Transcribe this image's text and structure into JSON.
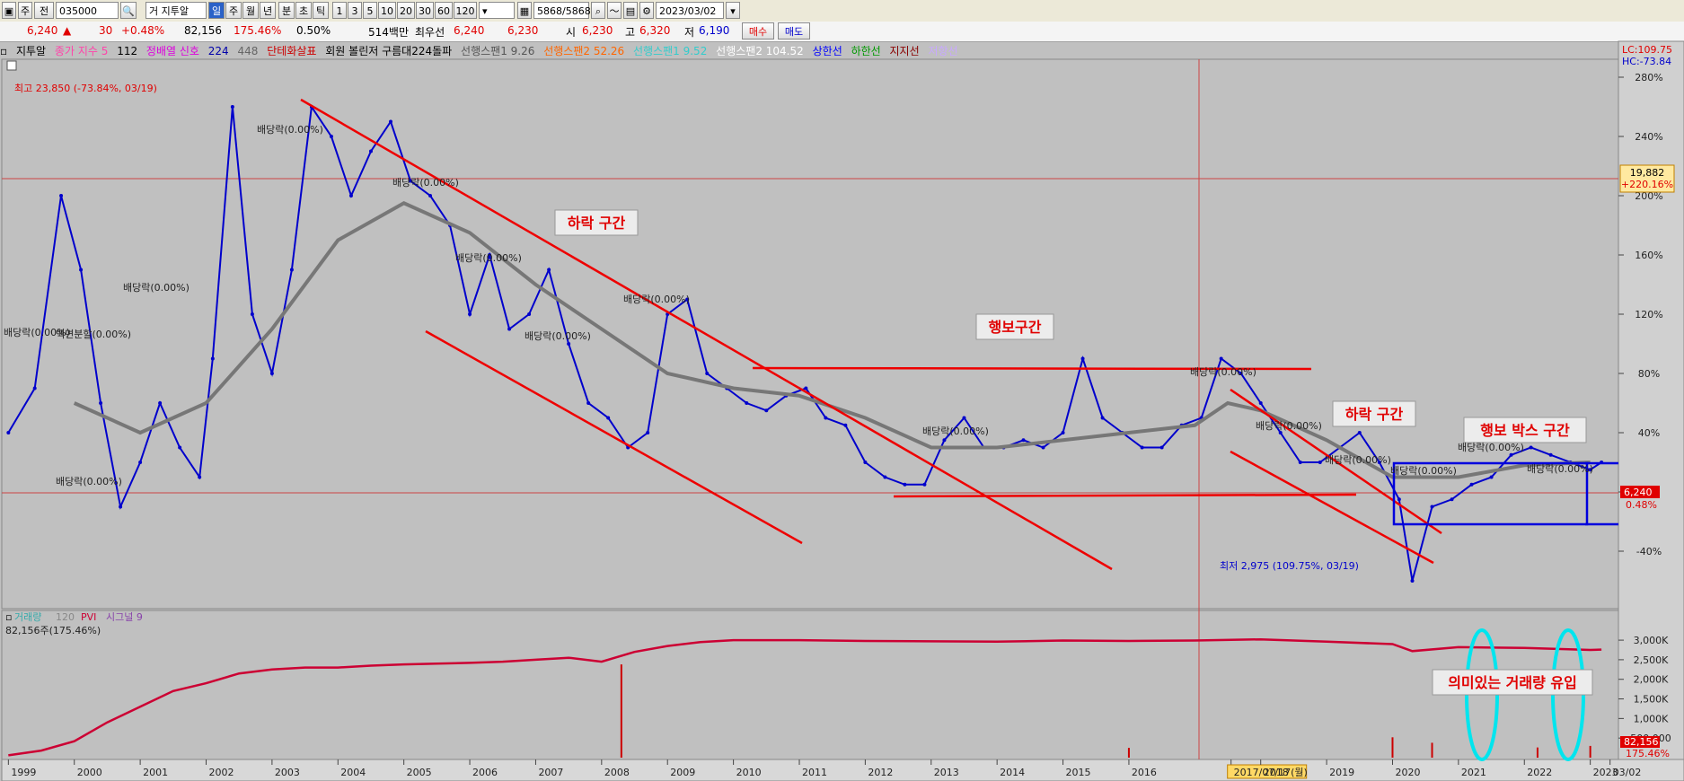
{
  "toolbar": {
    "code": "035000",
    "name": "지투알",
    "period_buttons": [
      "일",
      "주",
      "월",
      "년",
      "분",
      "초",
      "틱"
    ],
    "active_period": "일",
    "interval_buttons": [
      "1",
      "3",
      "5",
      "10",
      "20",
      "30",
      "60",
      "120"
    ],
    "count": "5868",
    "total": "/5868",
    "date": "2023/03/02",
    "buy_label": "매수",
    "sell_label": "매도",
    "left_buttons": [
      "주",
      "전"
    ]
  },
  "quote": {
    "price": "6,240",
    "arrow": "▲",
    "change": "30",
    "change_pct": "+0.48%",
    "volume": "82,156",
    "vol_ratio": "175.46%",
    "turnover": "0.50%",
    "amount": "514백만",
    "prior_label": "최우선",
    "ask": "6,240",
    "bid": "6,230",
    "open_label": "시",
    "open": "6,230",
    "high_label": "고",
    "high": "6,320",
    "low_label": "저",
    "low": "6,190"
  },
  "legend": [
    {
      "text": "지투알",
      "color": "#000000"
    },
    {
      "text": "종가 지수 5",
      "color": "#ff44aa"
    },
    {
      "text": "",
      "color": "#c8b400"
    },
    {
      "text": "112",
      "color": "#000000"
    },
    {
      "text": "정배열 신호",
      "color": "#dd00dd"
    },
    {
      "text": "224",
      "color": "#0000aa"
    },
    {
      "text": "448",
      "color": "#666666"
    },
    {
      "text": "단테화살표",
      "color": "#cc0000"
    },
    {
      "text": "회원 볼린저 구름대224돌파",
      "color": "#000000"
    },
    {
      "text": "선행스팬1 9.26",
      "color": "#555555"
    },
    {
      "text": "선행스팬2 52.26",
      "color": "#ff6600"
    },
    {
      "text": "선행스팬1 9.52",
      "color": "#33cccc"
    },
    {
      "text": "선행스팬2 104.52",
      "color": "#ffffff"
    },
    {
      "text": "상한선",
      "color": "#0000ff"
    },
    {
      "text": "하한선",
      "color": "#009900"
    },
    {
      "text": "지지선",
      "color": "#880000"
    },
    {
      "text": "저항선",
      "color": "#c8a8ff"
    }
  ],
  "chart_data": {
    "type": "line",
    "title": "지투알",
    "x_ticks": [
      "1999",
      "2000",
      "2001",
      "2002",
      "2003",
      "2004",
      "2005",
      "2006",
      "2007",
      "2008",
      "2009",
      "2010",
      "2011",
      "2012",
      "2013",
      "2014",
      "2015",
      "2016",
      "2017/07/17(월)",
      "2018",
      "2019",
      "2020",
      "2021",
      "2022",
      "2023",
      "03/02"
    ],
    "y_ticks": [
      "280%",
      "240%",
      "200%",
      "160%",
      "120%",
      "80%",
      "40%",
      "0%",
      "-40%"
    ],
    "ylim": [
      -60,
      300
    ],
    "lc_label": "LC:109.75",
    "hc_label": "HC:-73.84",
    "crosshair_value": "19,882",
    "crosshair_pct": "+220.16%",
    "current_value": "6,240",
    "current_pct": "0.48%",
    "series": [
      {
        "name": "지투알",
        "color": "#0000cc",
        "x": [
          1999.0,
          1999.4,
          1999.8,
          2000.1,
          2000.4,
          2000.7,
          2001.0,
          2001.3,
          2001.6,
          2001.9,
          2002.1,
          2002.4,
          2002.7,
          2003.0,
          2003.3,
          2003.6,
          2003.9,
          2004.2,
          2004.5,
          2004.8,
          2005.1,
          2005.4,
          2005.7,
          2006.0,
          2006.3,
          2006.6,
          2006.9,
          2007.2,
          2007.5,
          2007.8,
          2008.1,
          2008.4,
          2008.7,
          2009.0,
          2009.3,
          2009.6,
          2009.9,
          2010.2,
          2010.5,
          2010.8,
          2011.1,
          2011.4,
          2011.7,
          2012.0,
          2012.3,
          2012.6,
          2012.9,
          2013.2,
          2013.5,
          2013.8,
          2014.1,
          2014.4,
          2014.7,
          2015.0,
          2015.3,
          2015.6,
          2015.9,
          2016.2,
          2016.5,
          2016.8,
          2017.1,
          2017.4,
          2017.7,
          2018.0,
          2018.3,
          2018.6,
          2018.9,
          2019.2,
          2019.5,
          2019.8,
          2020.1,
          2020.3,
          2020.6,
          2020.9,
          2021.2,
          2021.5,
          2021.8,
          2022.1,
          2022.4,
          2022.7,
          2023.0,
          2023.17
        ],
        "y": [
          40,
          70,
          200,
          150,
          60,
          -10,
          20,
          60,
          30,
          10,
          90,
          260,
          120,
          80,
          150,
          260,
          240,
          200,
          230,
          250,
          210,
          200,
          180,
          120,
          160,
          110,
          120,
          150,
          100,
          60,
          50,
          30,
          40,
          120,
          130,
          80,
          70,
          60,
          55,
          65,
          70,
          50,
          45,
          20,
          10,
          5,
          5,
          35,
          50,
          30,
          30,
          35,
          30,
          40,
          90,
          50,
          40,
          30,
          30,
          45,
          50,
          90,
          80,
          60,
          40,
          20,
          20,
          30,
          40,
          20,
          -5,
          -60,
          -10,
          -5,
          5,
          10,
          25,
          30,
          25,
          20,
          15,
          20
        ]
      },
      {
        "name": "448",
        "color": "#777777",
        "x": [
          2000.0,
          2001.0,
          2002.0,
          2003.0,
          2004.0,
          2005.0,
          2006.0,
          2007.0,
          2008.0,
          2009.0,
          2010.0,
          2011.0,
          2012.0,
          2013.0,
          2014.0,
          2015.0,
          2016.0,
          2017.0,
          2017.5,
          2018.0,
          2019.0,
          2020.0,
          2021.0,
          2022.0,
          2023.0
        ],
        "y": [
          60,
          40,
          60,
          110,
          170,
          195,
          175,
          140,
          110,
          80,
          70,
          65,
          50,
          30,
          30,
          35,
          40,
          45,
          60,
          55,
          35,
          10,
          10,
          18,
          20
        ]
      }
    ],
    "dividend_labels": [
      "배당락(0.00%)",
      "배당락(0.00%)",
      "배당락(0.00%)",
      "배당락(0.00%)",
      "배당락(0.00%)",
      "배당락(0.00%)",
      "배당락(0.00%)",
      "배당락(0.00%)",
      "배당락(0.00%)",
      "배당락(0.00%)",
      "배당락(0.00%)",
      "배당락(0.00%)",
      "배당락(0.00%)",
      "배당락(0.00%)",
      "배당락(0.00%)"
    ],
    "split_label": "액면분할(0.00%)",
    "max_label": "최고 23,850 (-73.84%, 03/19)",
    "min_label": "최저 2,975 (109.75%, 03/19)",
    "annotations": [
      "하락 구간",
      "행보구간",
      "하락 구간",
      "행보 박스 구간"
    ]
  },
  "volume_panel": {
    "legend": [
      {
        "text": "거래량",
        "color": "#33aaaa"
      },
      {
        "text": "120",
        "color": "#888888"
      },
      {
        "text": "PVI",
        "color": "#cc0033"
      },
      {
        "text": "시그널 9",
        "color": "#8844aa"
      }
    ],
    "vol_text": "82,156주(175.46%)",
    "y_ticks": [
      "3,000K",
      "2,500K",
      "2,000K",
      "1,500K",
      "1,000K",
      "500,000"
    ],
    "current_vol": "82,156",
    "current_vol_pct": "175.46%",
    "annotation": "의미있는 거래량 유입",
    "pvi": {
      "x": [
        1999.0,
        1999.5,
        2000.0,
        2000.5,
        2001.0,
        2001.5,
        2002.0,
        2002.5,
        2003.0,
        2003.5,
        2004.0,
        2004.5,
        2005.0,
        2005.5,
        2006.0,
        2006.5,
        2007.0,
        2007.5,
        2008.0,
        2008.5,
        2009.0,
        2009.5,
        2010.0,
        2011.0,
        2012.0,
        2013.0,
        2014.0,
        2015.0,
        2016.0,
        2017.0,
        2018.0,
        2019.0,
        2020.0,
        2020.3,
        2021.0,
        2022.0,
        2023.0,
        2023.17
      ],
      "y": [
        60,
        180,
        420,
        900,
        1300,
        1700,
        1900,
        2150,
        2250,
        2300,
        2300,
        2350,
        2380,
        2400,
        2420,
        2450,
        2500,
        2550,
        2450,
        2700,
        2850,
        2950,
        3000,
        3000,
        2980,
        2970,
        2960,
        2990,
        2980,
        2990,
        3020,
        2960,
        2900,
        2720,
        2820,
        2800,
        2750,
        2760
      ]
    },
    "spikes": [
      {
        "x": 2008.3,
        "v": 2380
      },
      {
        "x": 2016.0,
        "v": 250
      },
      {
        "x": 2020.0,
        "v": 520
      },
      {
        "x": 2020.6,
        "v": 380
      },
      {
        "x": 2022.2,
        "v": 260
      },
      {
        "x": 2023.0,
        "v": 300
      }
    ]
  },
  "colors": {
    "background": "#c0c0c0",
    "trend": "#ee0000",
    "box": "#0000dd",
    "highlight": "#00e5ee"
  }
}
